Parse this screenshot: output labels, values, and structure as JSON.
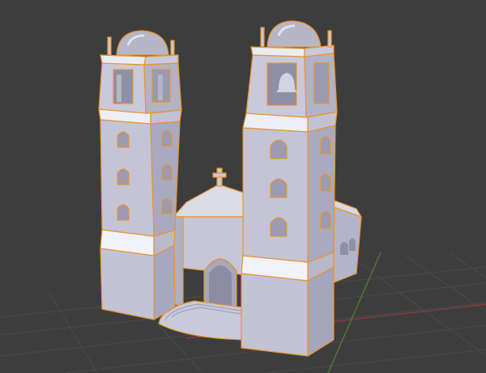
{
  "viewport": {
    "background_color": "#3d3d3d",
    "grid_line_color": "#4a4a4a",
    "x_axis_color": "#8a3b3b",
    "y_axis_color": "#4f7a2f",
    "selection_outline_color": "#e8952c"
  },
  "model": {
    "object": "church-with-twin-bell-towers",
    "selected": true,
    "shading": "solid",
    "colors": {
      "lit_face": "#f0f0fb",
      "mid_face": "#c4c4d6",
      "shade_face": "#a9a9bf",
      "dark_face": "#8f8fa6",
      "opening": "#8a8aa2",
      "dome": "#b6b6c6"
    }
  }
}
